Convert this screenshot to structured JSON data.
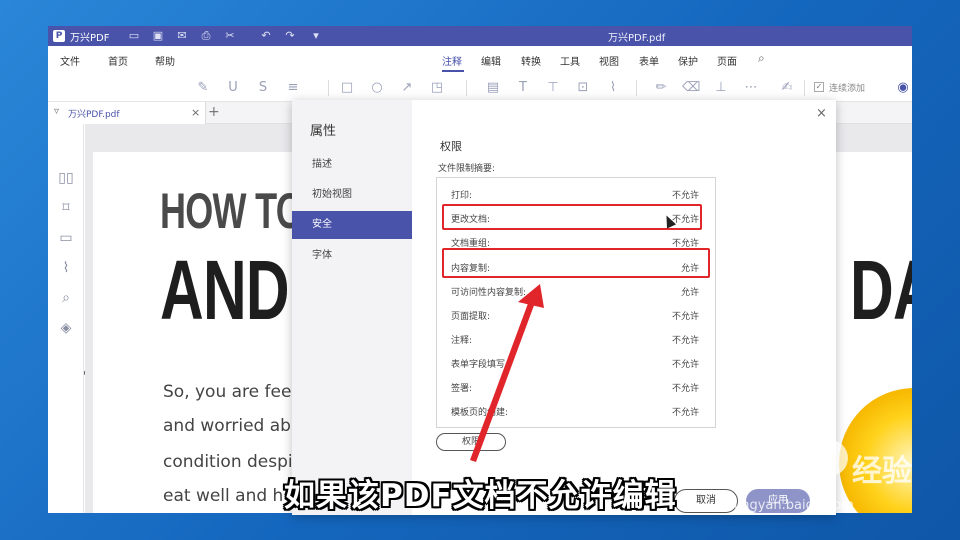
{
  "titlebar": {
    "logo": "P",
    "app_name": "万兴PDF",
    "doc_title": "万兴PDF.pdf"
  },
  "menubar": {
    "left": [
      "文件",
      "首页",
      "帮助"
    ],
    "tabs": [
      "注释",
      "编辑",
      "转换",
      "工具",
      "视图",
      "表单",
      "保护",
      "页面"
    ],
    "active_tab": "注释"
  },
  "toolbar": {
    "continuous_add_label": "连续添加",
    "continuous_add_checked": "✓"
  },
  "tabbar": {
    "tab_label": "万兴PDF.pdf",
    "close": "×",
    "add": "+"
  },
  "document": {
    "headline_1": "HOW TO",
    "headline_2": "AND",
    "headline_3": "DA",
    "lines": [
      "So, you are feel",
      "and worried ab",
      "condition despi",
      "eat well and h"
    ]
  },
  "dialog": {
    "title": "属性",
    "nav": [
      "描述",
      "初始视图",
      "安全",
      "字体"
    ],
    "selected_nav": "安全",
    "close": "×",
    "section_title": "权限",
    "summary_label": "文件限制摘要:",
    "permissions": [
      {
        "label": "打印:",
        "value": "不允许"
      },
      {
        "label": "更改文档:",
        "value": "不允许"
      },
      {
        "label": "文档重组:",
        "value": "不允许"
      },
      {
        "label": "内容复制:",
        "value": "允许"
      },
      {
        "label": "可访问性内容复制:",
        "value": "允许"
      },
      {
        "label": "页面提取:",
        "value": "不允许"
      },
      {
        "label": "注释:",
        "value": "不允许"
      },
      {
        "label": "表单字段填写:",
        "value": "不允许"
      },
      {
        "label": "签署:",
        "value": "不允许"
      },
      {
        "label": "模板页的创建:",
        "value": "不允许"
      }
    ],
    "permissions_button": "权限",
    "cancel_button": "取消",
    "apply_button": "应用"
  },
  "overlay": {
    "caption": "如果该PDF文档不允许编辑",
    "watermark_text": "Bai",
    "watermark_cn": "经验",
    "watermark_url": "jingyan.baidu.com",
    "highlight_color": "#e0262b"
  }
}
